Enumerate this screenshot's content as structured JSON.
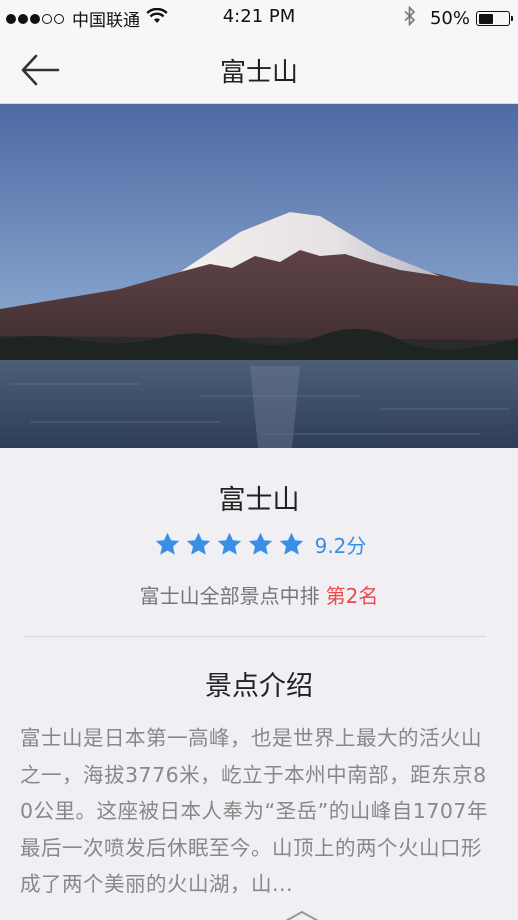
{
  "status_bar": {
    "carrier": "中国联通",
    "time": "4:21 PM",
    "battery_percent": "50%",
    "battery_level": 0.5,
    "signal_bars_filled": 3,
    "signal_bars_total": 5
  },
  "nav": {
    "title": "富士山",
    "back_icon": "arrow-left-icon"
  },
  "spot": {
    "name": "富士山",
    "rating_stars": 5,
    "score": "9.2分",
    "rank_prefix": "富士山全部景点中排",
    "rank_value": "第2名"
  },
  "intro": {
    "title": "景点介绍",
    "text": "富士山是日本第一高峰，也是世界上最大的活火山之一，海拔3776米，屹立于本州中南部，距东京80公里。这座被日本人奉为“圣岳”的山峰自1707年最后一次喷发后休眠至今。山顶上的两个火山口形成了两个美丽的火山湖，山..."
  },
  "colors": {
    "accent_blue": "#3a8ee6",
    "rank_red": "#f04848",
    "background": "#efeff4"
  }
}
